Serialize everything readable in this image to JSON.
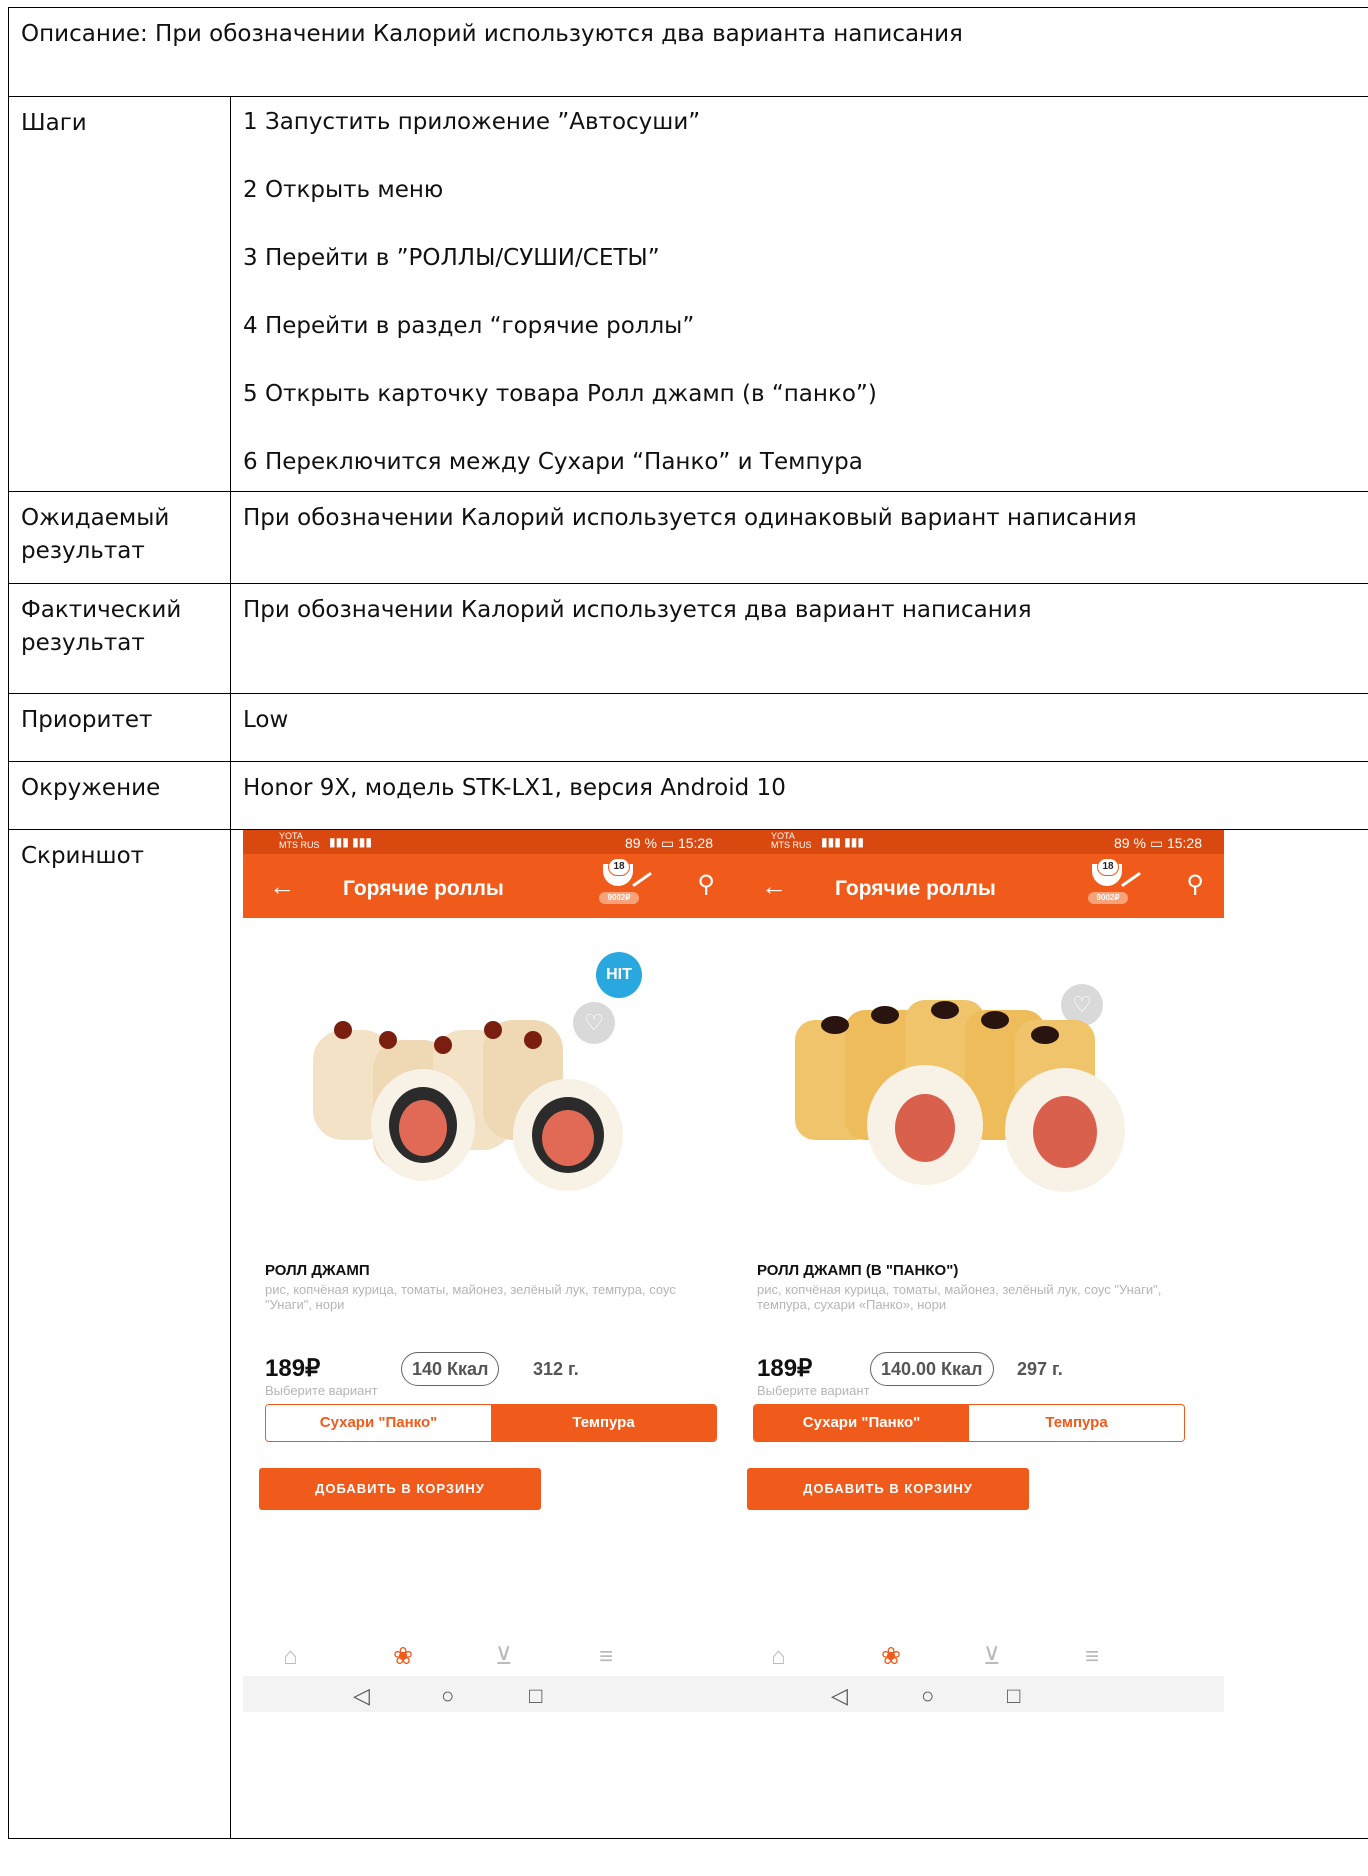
{
  "description": "Описание: При обозначении Калорий используются два варианта написания",
  "rows": {
    "steps_label": "Шаги",
    "steps": [
      "1 Запустить приложение  ”Автосуши”",
      "2 Открыть меню",
      "3 Перейти в ”РОЛЛЫ/СУШИ/СЕТЫ”",
      "4 Перейти в раздел “горячие роллы”",
      "5 Открыть карточку товара Ролл джамп (в “панко”)",
      "6 Переключится между Сухари “Панко” и Темпура"
    ],
    "expected_label": "Ожидаемый результат",
    "expected": "При обозначении Калорий используется одинаковый вариант написания",
    "actual_label": "Фактический результат",
    "actual": "При обозначении Калорий используется два вариант написания",
    "priority_label": "Приоритет",
    "priority": "Low",
    "env_label": "Окружение",
    "env": "Honor 9X, модель STK-LX1, версия Android 10",
    "screenshot_label": "Скриншот"
  },
  "phones": {
    "left": {
      "carrier": "YOTA",
      "carrier2": "MTS RUS",
      "battery": "89 %",
      "time": "15:28",
      "title": "Горячие роллы",
      "cart_count": "18",
      "cart_price": "9002₽",
      "badge": "HIT",
      "name": "РОЛЛ ДЖАМП",
      "ingredients": "рис, копчёная курица, томаты, майонез, зелёный лук, темпура, соус \"Унаги\", нори",
      "price": "189₽",
      "kcal": "140 Ккал",
      "weight": "312 г.",
      "hint": "Выберите вариант",
      "opt1": "Сухари \"Панко\"",
      "opt2": "Темпура",
      "selected": "opt2",
      "add": "ДОБАВИТЬ В КОРЗИНУ"
    },
    "right": {
      "carrier": "YOTA",
      "carrier2": "MTS RUS",
      "battery": "89 %",
      "time": "15:28",
      "title": "Горячие роллы",
      "cart_count": "18",
      "cart_price": "9002₽",
      "name": "РОЛЛ ДЖАМП (В \"ПАНКО\")",
      "ingredients": "рис, копчёная курица, томаты, майонез, зелёный лук, соус \"Унаги\", темпура, сухари «Панко», нори",
      "price": "189₽",
      "kcal": "140.00 Ккал",
      "weight": "297 г.",
      "hint": "Выберите вариант",
      "opt1": "Сухари \"Панко\"",
      "opt2": "Темпура",
      "selected": "opt1",
      "add": "ДОБАВИТЬ В КОРЗИНУ"
    }
  },
  "icons": {
    "back": "arrow-left-icon",
    "search": "search-icon",
    "cart": "cart-bowl-icon",
    "heart": "heart-icon",
    "home": "home-icon",
    "menu_sushi": "sushi-icon",
    "basket": "basket-icon",
    "hamburger": "menu-icon"
  },
  "colors": {
    "accent": "#f05a1a",
    "statusbar": "#d9480f",
    "hit_badge": "#29a8e0"
  }
}
